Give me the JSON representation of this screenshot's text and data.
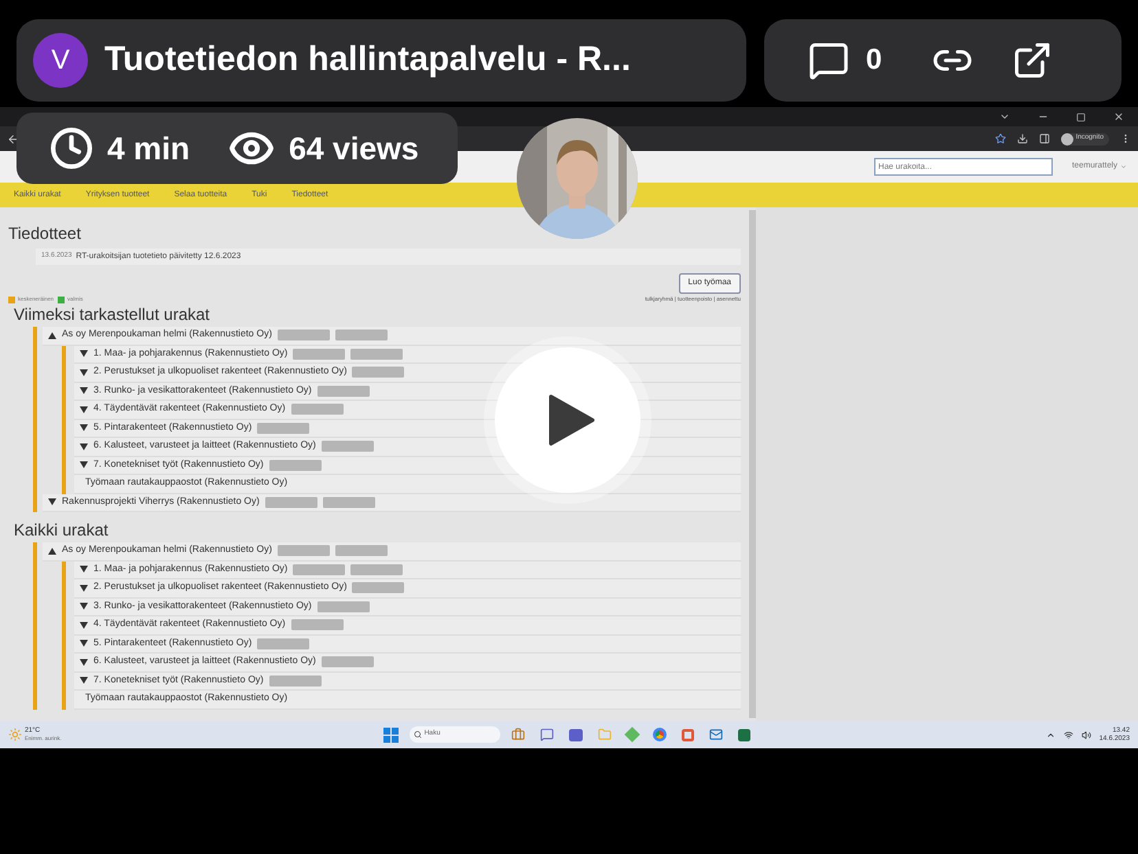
{
  "header": {
    "avatar_letter": "V",
    "title": "Tuotetiedon hallintapalvelu - R..."
  },
  "actions": {
    "comments": "0"
  },
  "stats": {
    "duration": "4 min",
    "views": "64 views"
  },
  "browser": {
    "profile": "Incognito"
  },
  "site": {
    "search": {
      "placeholder": "Hae urakoita..."
    },
    "user": "teemurattely"
  },
  "nav": [
    "Kaikki urakat",
    "Yrityksen tuotteet",
    "Selaa tuotteita",
    "Tuki",
    "Tiedotteet"
  ],
  "news": {
    "heading": "Tiedotteet",
    "items": [
      {
        "date": "13.6.2023",
        "text": "RT-urakoitsijan tuotetieto päivitetty 12.6.2023"
      }
    ]
  },
  "create_button": "Luo työmaa",
  "legend": [
    {
      "label": "keskeneräinen",
      "color": "#e8a317"
    },
    {
      "label": "valmis",
      "color": "#3cb043"
    }
  ],
  "links": "tulkjaryhmä | tuotteenpoisto | asennettu",
  "sections": [
    {
      "title": "Viimeksi tarkastellut urakat",
      "items": [
        {
          "kind": "group",
          "expanded": true,
          "label": "As oy Merenpoukaman helmi (Rakennustieto Oy)",
          "badges": [
            {
              "kind": "blurred"
            },
            {
              "kind": "blurred"
            }
          ],
          "children": [
            {
              "kind": "group",
              "expanded": false,
              "label": "1. Maa- ja pohjarakennus (Rakennustieto Oy)",
              "badges": [
                {
                  "kind": "blurred"
                },
                {
                  "kind": "blurred"
                }
              ]
            },
            {
              "kind": "group",
              "expanded": false,
              "label": "2. Perustukset ja ulkopuoliset rakenteet (Rakennustieto Oy)",
              "badges": [
                {
                  "kind": "blurred"
                }
              ]
            },
            {
              "kind": "group",
              "expanded": false,
              "label": "3. Runko- ja vesikattorakenteet (Rakennustieto Oy)",
              "badges": [
                {
                  "kind": "blurred"
                }
              ]
            },
            {
              "kind": "group",
              "expanded": false,
              "label": "4. Täydentävät rakenteet (Rakennustieto Oy)",
              "badges": [
                {
                  "kind": "blurred"
                }
              ]
            },
            {
              "kind": "group",
              "expanded": false,
              "label": "5. Pintarakenteet (Rakennustieto Oy)",
              "badges": [
                {
                  "kind": "blurred"
                }
              ]
            },
            {
              "kind": "group",
              "expanded": false,
              "label": "6. Kalusteet, varusteet ja laitteet (Rakennustieto Oy)",
              "badges": [
                {
                  "kind": "blurred"
                }
              ]
            },
            {
              "kind": "group",
              "expanded": false,
              "label": "7. Konetekniset työt (Rakennustieto Oy)",
              "badges": [
                {
                  "kind": "blurred"
                }
              ]
            },
            {
              "kind": "leaf",
              "label": "Työmaan rautakauppaostot (Rakennustieto Oy)"
            }
          ]
        },
        {
          "kind": "group",
          "expanded": false,
          "label": "Rakennusprojekti Viherrys (Rakennustieto Oy)",
          "badges": [
            {
              "kind": "blurred"
            },
            {
              "kind": "blurred"
            }
          ]
        }
      ]
    },
    {
      "title": "Kaikki urakat",
      "items": [
        {
          "kind": "group",
          "expanded": true,
          "label": "As oy Merenpoukaman helmi (Rakennustieto Oy)",
          "badges": [
            {
              "kind": "blurred"
            },
            {
              "kind": "blurred"
            }
          ],
          "children": [
            {
              "kind": "group",
              "expanded": false,
              "label": "1. Maa- ja pohjarakennus (Rakennustieto Oy)",
              "badges": [
                {
                  "kind": "blurred"
                },
                {
                  "kind": "blurred"
                }
              ]
            },
            {
              "kind": "group",
              "expanded": false,
              "label": "2. Perustukset ja ulkopuoliset rakenteet (Rakennustieto Oy)",
              "badges": [
                {
                  "kind": "blurred"
                }
              ]
            },
            {
              "kind": "group",
              "expanded": false,
              "label": "3. Runko- ja vesikattorakenteet (Rakennustieto Oy)",
              "badges": [
                {
                  "kind": "blurred"
                }
              ]
            },
            {
              "kind": "group",
              "expanded": false,
              "label": "4. Täydentävät rakenteet (Rakennustieto Oy)",
              "badges": [
                {
                  "kind": "blurred"
                }
              ]
            },
            {
              "kind": "group",
              "expanded": false,
              "label": "5. Pintarakenteet (Rakennustieto Oy)",
              "badges": [
                {
                  "kind": "blurred"
                }
              ]
            },
            {
              "kind": "group",
              "expanded": false,
              "label": "6. Kalusteet, varusteet ja laitteet (Rakennustieto Oy)",
              "badges": [
                {
                  "kind": "blurred"
                }
              ]
            },
            {
              "kind": "group",
              "expanded": false,
              "label": "7. Konetekniset työt (Rakennustieto Oy)",
              "badges": [
                {
                  "kind": "blurred"
                }
              ]
            },
            {
              "kind": "leaf",
              "label": "Työmaan rautakauppaostot (Rakennustieto Oy)"
            }
          ]
        }
      ]
    }
  ],
  "taskbar": {
    "weather_temp": "21°C",
    "weather_text": "Enimm. aurink.",
    "search_placeholder": "Haku",
    "time": "13.42",
    "date": "14.6.2023"
  }
}
